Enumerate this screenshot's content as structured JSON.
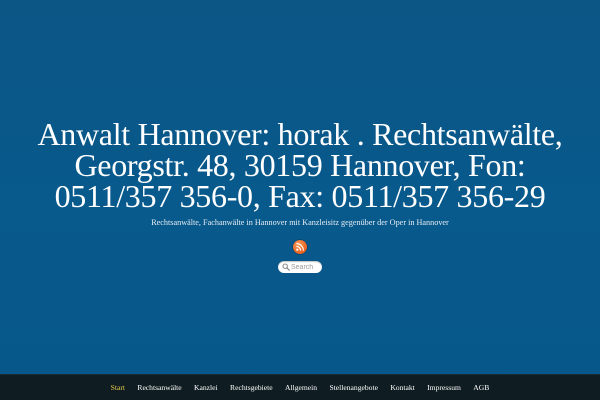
{
  "site": {
    "title": "Anwalt Hannover: horak . Rechtsanwälte, Georgstr. 48, 30159 Hannover, Fon: 0511/357 356-0, Fax: 0511/357 356-29",
    "tagline": "Rechtsanwälte, Fachanwälte in Hannover mit Kanzleisitz gegenüber der Oper in Hannover"
  },
  "icons": {
    "rss": "rss-icon",
    "search": "search-icon"
  },
  "search": {
    "value": "",
    "placeholder": "Search"
  },
  "nav": {
    "items": [
      {
        "label": "Start",
        "active": true
      },
      {
        "label": "Rechtsanwälte",
        "active": false
      },
      {
        "label": "Kanzlei",
        "active": false
      },
      {
        "label": "Rechtsgebiete",
        "active": false
      },
      {
        "label": "Allgemein",
        "active": false
      },
      {
        "label": "Stellenangebote",
        "active": false
      },
      {
        "label": "Kontakt",
        "active": false
      },
      {
        "label": "Impressum",
        "active": false
      },
      {
        "label": "AGB",
        "active": false
      }
    ]
  },
  "colors": {
    "background": "#08598c",
    "nav_background": "#0f1d22",
    "nav_active": "#e8c94a",
    "rss_orange": "#ee6c2c"
  }
}
